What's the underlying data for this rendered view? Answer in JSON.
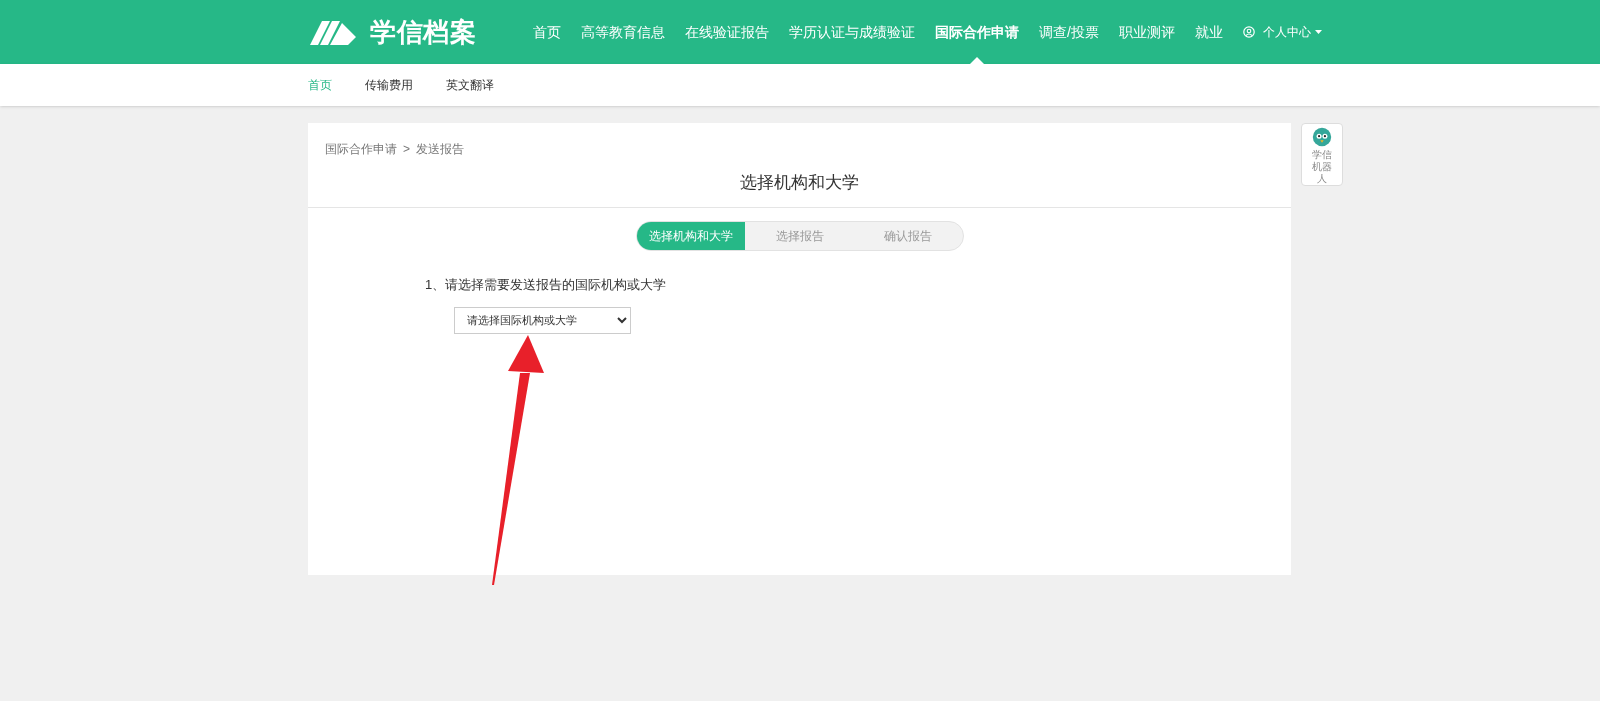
{
  "header": {
    "logo_text": "学信档案",
    "nav": [
      {
        "label": "首页",
        "selected": false
      },
      {
        "label": "高等教育信息",
        "selected": false
      },
      {
        "label": "在线验证报告",
        "selected": false
      },
      {
        "label": "学历认证与成绩验证",
        "selected": false
      },
      {
        "label": "国际合作申请",
        "selected": true
      },
      {
        "label": "调查/投票",
        "selected": false
      },
      {
        "label": "职业测评",
        "selected": false
      },
      {
        "label": "就业",
        "selected": false
      }
    ],
    "user_menu": "个人中心"
  },
  "subnav": [
    {
      "label": "首页",
      "selected": true
    },
    {
      "label": "传输费用",
      "selected": false
    },
    {
      "label": "英文翻译",
      "selected": false
    }
  ],
  "breadcrumb": [
    "国际合作申请",
    "发送报告"
  ],
  "breadcrumb_separator": ">",
  "page_title": "选择机构和大学",
  "steps": [
    {
      "label": "选择机构和大学",
      "selected": true
    },
    {
      "label": "选择报告",
      "selected": false
    },
    {
      "label": "确认报告",
      "selected": false
    }
  ],
  "question": "1、请选择需要发送报告的国际机构或大学",
  "select": {
    "value": "请选择国际机构或大学"
  },
  "robot_widget": {
    "label": "学信机器人"
  }
}
